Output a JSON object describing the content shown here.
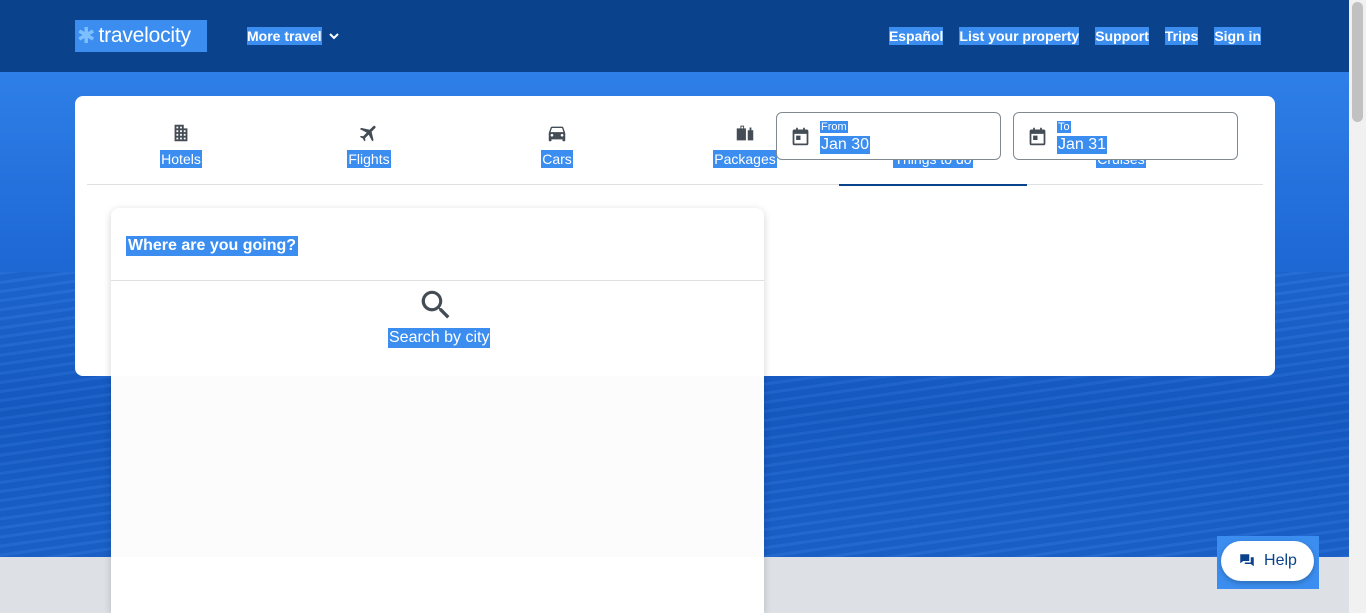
{
  "header": {
    "logo_text": "travelocity",
    "more_travel": "More travel",
    "nav": [
      "Español",
      "List your property",
      "Support",
      "Trips",
      "Sign in"
    ]
  },
  "tabs": [
    {
      "label": "Hotels",
      "icon": "building-icon"
    },
    {
      "label": "Flights",
      "icon": "airplane-icon"
    },
    {
      "label": "Cars",
      "icon": "car-icon"
    },
    {
      "label": "Packages",
      "icon": "luggage-icon"
    },
    {
      "label": "Things to do",
      "icon": "ticket-icon",
      "active": true
    },
    {
      "label": "Cruises",
      "icon": "ship-icon"
    }
  ],
  "search": {
    "placeholder": "Where are you going?",
    "hint": "Search by city"
  },
  "dates": {
    "from_label": "From",
    "from_value": "Jan 30",
    "to_label": "To",
    "to_value": "Jan 31"
  },
  "help": {
    "label": "Help"
  },
  "colors": {
    "header_bg": "#0a438b",
    "selection": "#3b8ef0",
    "hero": "#1f6ad7"
  }
}
